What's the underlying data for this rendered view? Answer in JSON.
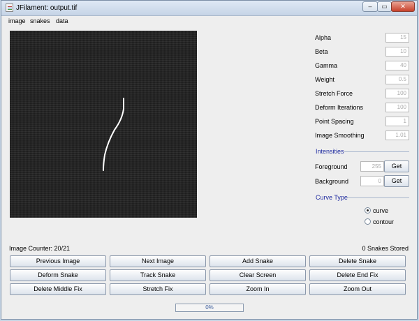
{
  "window": {
    "title": "JFilament: output.tif",
    "minimize_glyph": "–",
    "maximize_glyph": "▭",
    "close_glyph": "✕"
  },
  "menu": [
    "image",
    "snakes",
    "data"
  ],
  "parameters": [
    {
      "label": "Alpha",
      "value": "15"
    },
    {
      "label": "Beta",
      "value": "10"
    },
    {
      "label": "Gamma",
      "value": "40"
    },
    {
      "label": "Weight",
      "value": "0.5"
    },
    {
      "label": "Stretch Force",
      "value": "100"
    },
    {
      "label": "Deform Iterations",
      "value": "100"
    },
    {
      "label": "Point Spacing",
      "value": "1"
    },
    {
      "label": "Image Smoothing",
      "value": "1.01"
    }
  ],
  "intensities": {
    "title": "Intensities",
    "foreground": {
      "label": "Foreground",
      "value": "255",
      "button": "Get"
    },
    "background": {
      "label": "Background",
      "value": "0",
      "button": "Get"
    }
  },
  "curve_type": {
    "title": "Curve Type",
    "options": [
      {
        "label": "curve",
        "selected": true
      },
      {
        "label": "contour",
        "selected": false
      }
    ]
  },
  "status": {
    "image_counter": "Image Counter: 20/21",
    "snakes_stored": "0 Snakes Stored"
  },
  "buttons": [
    [
      "Previous Image",
      "Next Image",
      "Add Snake",
      "Delete Snake"
    ],
    [
      "Deform Snake",
      "Track Snake",
      "Clear Screen",
      "Delete End Fix"
    ],
    [
      "Delete Middle Fix",
      "Stretch Fix",
      "Zoom In",
      "Zoom Out"
    ]
  ],
  "progress": {
    "value": 0,
    "text": "0%"
  },
  "colors": {
    "accent_title": "#1f2ba0",
    "canvas_bg": "#1e1e1e",
    "filament": "#ffffff"
  }
}
